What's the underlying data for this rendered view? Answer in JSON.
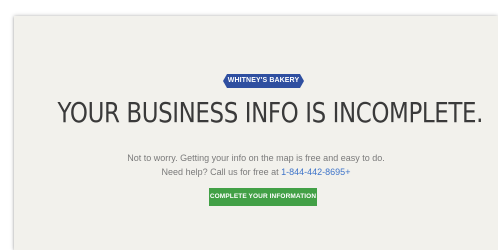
{
  "badge": {
    "label": "WHITNEY'S BAKERY"
  },
  "headline": {
    "text": "YOUR BUSINESS INFO IS INCOMPLETE."
  },
  "message": {
    "line1": "Not to worry. Getting your info on the map is free and easy to do.",
    "line2_prefix": "Need help? Call us for free at ",
    "phone": "1-844-442-8695",
    "phone_suffix": "+"
  },
  "cta": {
    "label": "COMPLETE YOUR INFORMATION"
  },
  "colors": {
    "badge": "#2f4fa0",
    "cta": "#42a046",
    "phone_link": "#3e74c9",
    "panel": "#f2f1ec"
  }
}
